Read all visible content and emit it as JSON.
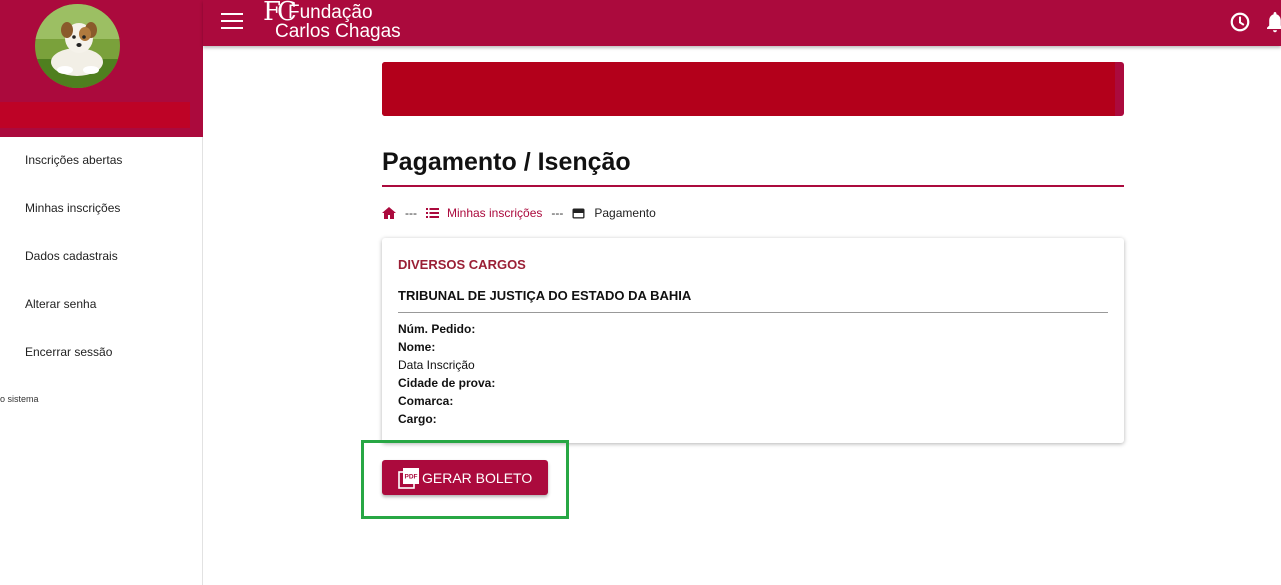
{
  "sidebar": {
    "user_name": "",
    "items": [
      {
        "label": "Inscrições abertas"
      },
      {
        "label": "Minhas inscrições"
      },
      {
        "label": "Dados cadastrais"
      },
      {
        "label": "Alterar senha"
      },
      {
        "label": "Encerrar sessão"
      }
    ],
    "footer_text": "o sistema"
  },
  "header": {
    "logo_mark": "FC",
    "logo_line1": "Fundação",
    "logo_line2": "Carlos Chagas",
    "icons": [
      "menu-icon",
      "clock-icon",
      "bell-icon"
    ]
  },
  "main": {
    "page_title": "Pagamento / Isenção",
    "breadcrumb": {
      "sep": "---",
      "link": "Minhas inscrições",
      "current": "Pagamento"
    },
    "card": {
      "cargo": "DIVERSOS CARGOS",
      "org": "TRIBUNAL DE JUSTIÇA DO ESTADO DA BAHIA",
      "fields": [
        {
          "label": "Núm. Pedido:"
        },
        {
          "label": "Nome:"
        },
        {
          "label": "Data Inscrição"
        },
        {
          "label": "Cidade de prova:"
        },
        {
          "label": "Comarca:"
        },
        {
          "label": "Cargo:"
        }
      ]
    },
    "button_label": "GERAR BOLETO"
  },
  "colors": {
    "brand": "#ab0a3d",
    "banner": "#b3001b",
    "highlight": "#27a744"
  }
}
